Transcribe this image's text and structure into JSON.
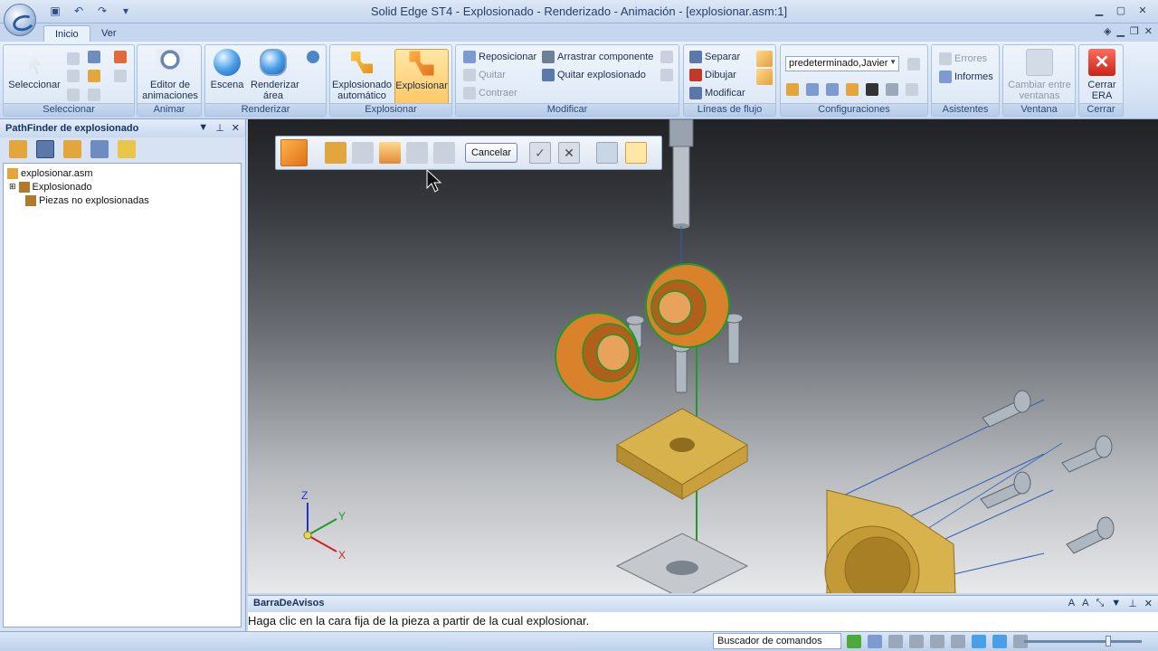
{
  "window": {
    "title": "Solid Edge ST4 - Explosionado - Renderizado - Animación - [explosionar.asm:1]"
  },
  "tabs": [
    {
      "label": "Inicio",
      "active": true
    },
    {
      "label": "Ver",
      "active": false
    }
  ],
  "ribbon": {
    "groups": {
      "seleccionar": "Seleccionar",
      "animar": "Animar",
      "renderizar": "Renderizar",
      "explosionar": "Explosionar",
      "modificar": "Modificar",
      "lineas_flujo": "Líneas de flujo",
      "configuraciones": "Configuraciones",
      "asistentes": "Asistentes",
      "ventana": "Ventana",
      "cerrar": "Cerrar"
    },
    "buttons": {
      "seleccionar": "Seleccionar",
      "editor_animaciones_1": "Editor de",
      "editor_animaciones_2": "animaciones",
      "escena": "Escena",
      "renderizar_area_1": "Renderizar",
      "renderizar_area_2": "área",
      "explosionado_auto_1": "Explosionado",
      "explosionado_auto_2": "automático",
      "explosionar": "Explosionar",
      "reposicionar": "Reposicionar",
      "quitar": "Quitar",
      "contraer": "Contraer",
      "arrastrar_componente": "Arrastrar componente",
      "quitar_explosionado": "Quitar explosionado",
      "separar": "Separar",
      "dibujar": "Dibujar",
      "modificar": "Modificar",
      "errores": "Errores",
      "informes": "Informes",
      "cambiar_ventanas_1": "Cambiar entre",
      "cambiar_ventanas_2": "ventanas",
      "cerrar_era_1": "Cerrar",
      "cerrar_era_2": "ERA"
    },
    "config_combo": "predeterminado,Javier"
  },
  "pathfinder": {
    "title": "PathFinder de explosionado",
    "tree": [
      {
        "label": "explosionar.asm"
      },
      {
        "label": "Explosionado"
      },
      {
        "label": "Piezas no explosionadas"
      }
    ]
  },
  "command_bar": {
    "cancel": "Cancelar"
  },
  "axes": {
    "z": "Z",
    "y": "Y",
    "x": "X"
  },
  "avisos": {
    "title": "BarraDeAvisos",
    "message": "Haga clic en la cara fija de la pieza a partir de la cual explosionar."
  },
  "statusbar": {
    "command_finder": "Buscador de comandos"
  },
  "colors": {
    "selection_green": "#1f9a2a",
    "part_orange": "#d9822b",
    "part_brass": "#d8b24c",
    "ribbon_blue": "#c7d8ef"
  },
  "icons": [
    "app-orb-icon",
    "save-icon",
    "undo-icon",
    "redo-icon",
    "select-arrow-icon",
    "scene-sphere-icon",
    "close-era-icon",
    "check-icon",
    "x-icon"
  ]
}
